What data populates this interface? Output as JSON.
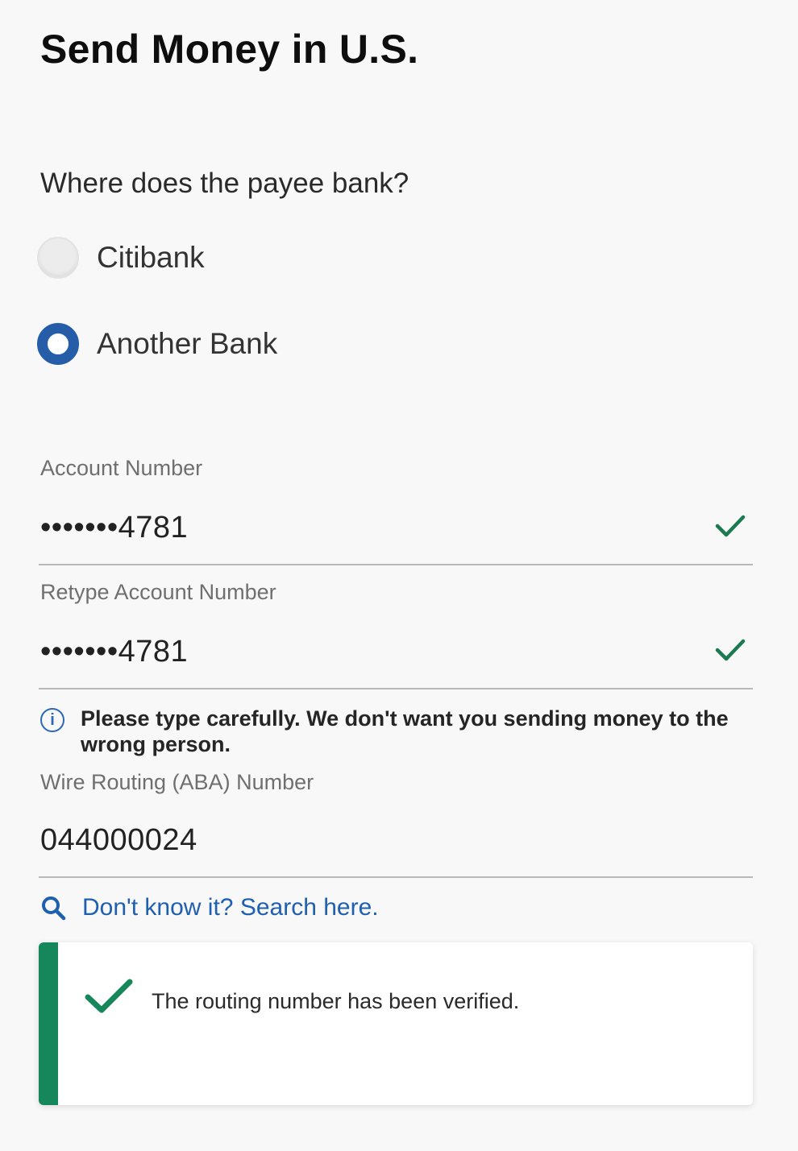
{
  "page": {
    "title": "Send Money in U.S."
  },
  "payee_bank": {
    "question": "Where does the payee bank?",
    "options": [
      {
        "label": "Citibank",
        "selected": false
      },
      {
        "label": "Another Bank",
        "selected": true
      }
    ]
  },
  "account_number": {
    "label": "Account Number",
    "value": "•••••••4781",
    "verified": true
  },
  "retype_account_number": {
    "label": "Retype Account Number",
    "value": "•••••••4781",
    "verified": true
  },
  "info_message": {
    "icon": "info-icon",
    "text": "Please type carefully. We don't want you sending money to the wrong person."
  },
  "routing_number": {
    "label": "Wire Routing (ABA) Number",
    "value": "044000024"
  },
  "search_link": {
    "icon": "search-icon",
    "text": "Don't know it? Search here."
  },
  "verification_alert": {
    "icon": "checkmark-icon",
    "text": "The routing number has been verified."
  },
  "colors": {
    "accent_blue": "#255da8",
    "link_blue": "#1f5fb0",
    "success_green": "#15875a",
    "check_green": "#1b7a4f"
  }
}
